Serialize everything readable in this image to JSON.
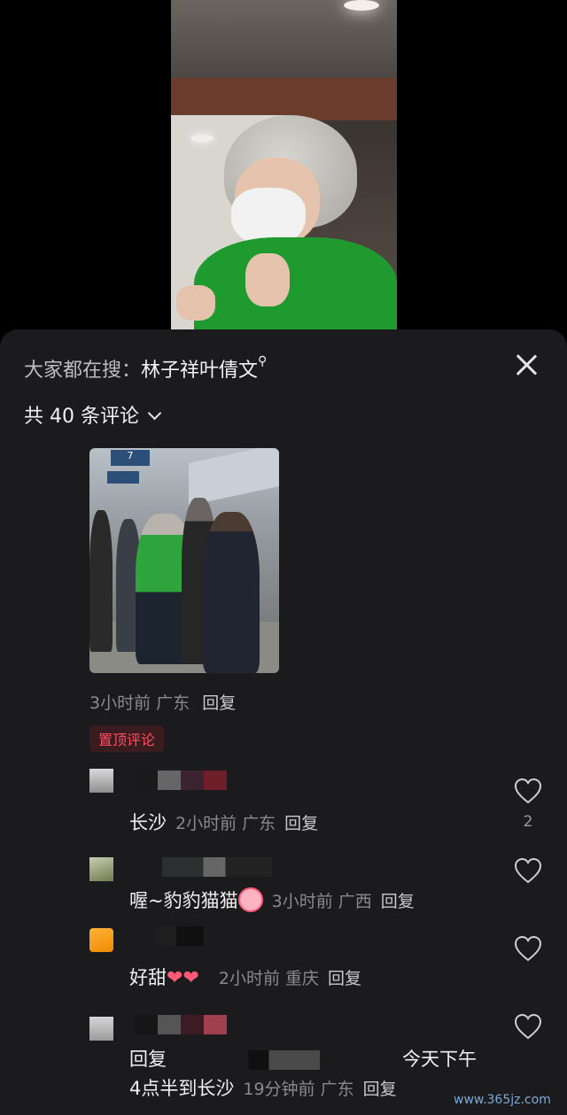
{
  "search_hint": {
    "prefix": "大家都在搜：",
    "keyword": "林子祥叶倩文",
    "suffix_icon": "search-icon"
  },
  "comment_count": "共 40 条评论",
  "top_post": {
    "sign_text": "7",
    "meta": "3小时前 广东",
    "reply": "回复",
    "pinned_label": "置顶评论"
  },
  "comments": [
    {
      "text": "长沙",
      "meta": "2小时前 广东",
      "reply": "回复",
      "likes": "2"
    },
    {
      "text": "喔~豹豹猫猫",
      "meta": "3小时前 广西",
      "reply": "回复"
    },
    {
      "text": "好甜",
      "meta": "2小时前 重庆",
      "reply": "回复"
    },
    {
      "text_line1_a": "回复",
      "text_line1_b": "今天下午",
      "text_line2": "4点半到长沙",
      "meta": "19分钟前 广东",
      "reply": "回复"
    }
  ],
  "watermark": "www.365jz.com",
  "colors": {
    "panel_bg": "#1b1b1d",
    "pinned_fg": "#ff4d5e",
    "accent_heart": "#ff5a78"
  }
}
